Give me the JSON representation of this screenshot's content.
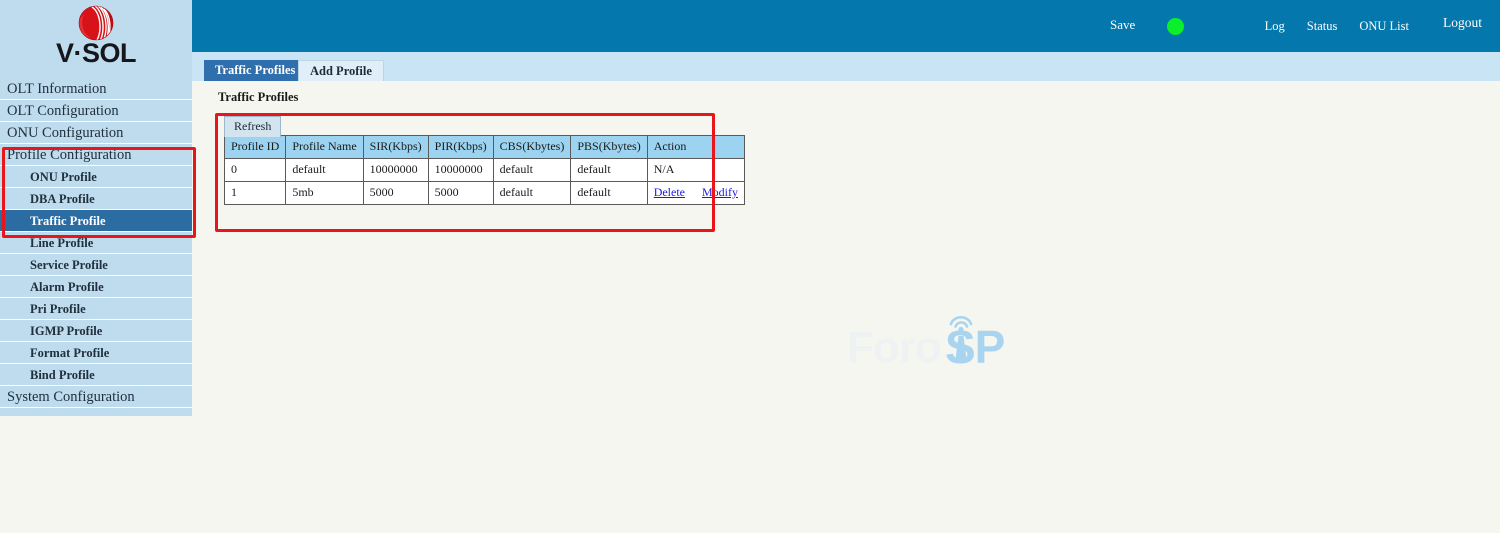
{
  "brand": {
    "name": "V·SOL",
    "logo_icon": "vsol-sphere-logo"
  },
  "header": {
    "save_label": "Save",
    "status_indicator_color": "#0bee2b",
    "status_indicator_icon": "status-dot-icon",
    "links": [
      {
        "label": "Log",
        "name": "log"
      },
      {
        "label": "Status",
        "name": "status"
      },
      {
        "label": "ONU List",
        "name": "onu-list"
      }
    ],
    "logout_label": "Logout",
    "background_color": "#0477ac"
  },
  "sidebar": {
    "items": [
      {
        "label": "OLT Information",
        "level": "top",
        "selected": false
      },
      {
        "label": "OLT Configuration",
        "level": "top",
        "selected": false
      },
      {
        "label": "ONU Configuration",
        "level": "top",
        "selected": false
      },
      {
        "label": "Profile Configuration",
        "level": "top",
        "selected": false
      },
      {
        "label": "ONU Profile",
        "level": "sub",
        "selected": false
      },
      {
        "label": "DBA Profile",
        "level": "sub",
        "selected": false
      },
      {
        "label": "Traffic Profile",
        "level": "sub",
        "selected": true
      },
      {
        "label": "Line Profile",
        "level": "sub",
        "selected": false
      },
      {
        "label": "Service Profile",
        "level": "sub",
        "selected": false
      },
      {
        "label": "Alarm Profile",
        "level": "sub",
        "selected": false
      },
      {
        "label": "Pri Profile",
        "level": "sub",
        "selected": false
      },
      {
        "label": "IGMP Profile",
        "level": "sub",
        "selected": false
      },
      {
        "label": "Format Profile",
        "level": "sub",
        "selected": false
      },
      {
        "label": "Bind Profile",
        "level": "sub",
        "selected": false
      },
      {
        "label": "System Configuration",
        "level": "top",
        "selected": false
      }
    ],
    "background_color": "#bfdcef",
    "selected_color": "#2b6ca3"
  },
  "tabs": [
    {
      "label": "Traffic Profiles",
      "active": true
    },
    {
      "label": "Add Profile",
      "active": false
    }
  ],
  "main": {
    "page_title": "Traffic Profiles",
    "refresh_label": "Refresh",
    "table": {
      "columns": [
        "Profile ID",
        "Profile Name",
        "SIR(Kbps)",
        "PIR(Kbps)",
        "CBS(Kbytes)",
        "PBS(Kbytes)",
        "Action"
      ],
      "rows": [
        {
          "profile_id": "0",
          "profile_name": "default",
          "sir": "10000000",
          "pir": "10000000",
          "cbs": "default",
          "pbs": "default",
          "action_text": "N/A",
          "has_links": false
        },
        {
          "profile_id": "1",
          "profile_name": "5mb",
          "sir": "5000",
          "pir": "5000",
          "cbs": "default",
          "pbs": "default",
          "action_text": "",
          "has_links": true,
          "delete_label": "Delete",
          "modify_label": "Modify"
        }
      ]
    }
  },
  "watermark": {
    "text_left": "Foro",
    "text_right": "SP",
    "icon": "antenna-tower-icon",
    "color_left": "#eef2f2",
    "color_right": "#a9d4ef"
  },
  "annotations": {
    "highlight_color": "#e8161a",
    "boxes": [
      {
        "name": "sidebar-profile-section-highlight"
      },
      {
        "name": "traffic-profiles-table-highlight"
      }
    ]
  }
}
